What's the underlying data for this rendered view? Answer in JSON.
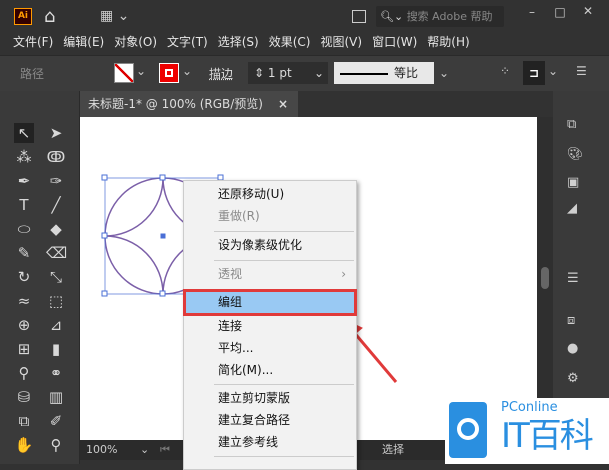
{
  "app": {
    "logo": "Ai",
    "search_placeholder": "搜索 Adobe 帮助"
  },
  "menu": [
    "文件(F)",
    "编辑(E)",
    "对象(O)",
    "文字(T)",
    "选择(S)",
    "效果(C)",
    "视图(V)",
    "窗口(W)",
    "帮助(H)"
  ],
  "control": {
    "object_type": "路径",
    "stroke_label": "描边",
    "stroke_value": "1 pt",
    "profile": "等比"
  },
  "document_tab": {
    "title": "未标题-1* @ 100% (RGB/预览)",
    "close": "×"
  },
  "status": {
    "zoom": "100%",
    "tool": "选择"
  },
  "context_menu": {
    "items": [
      {
        "label": "还原移动(U)",
        "enabled": true
      },
      {
        "label": "重做(R)",
        "enabled": false
      },
      {
        "label": "设为像素级优化",
        "enabled": true
      },
      {
        "label": "透视",
        "enabled": false,
        "submenu": "›"
      },
      {
        "label": "编组",
        "enabled": true,
        "highlighted": true
      },
      {
        "label": "连接",
        "enabled": true
      },
      {
        "label": "平均...",
        "enabled": true
      },
      {
        "label": "简化(M)...",
        "enabled": true
      },
      {
        "label": "建立剪切蒙版",
        "enabled": true
      },
      {
        "label": "建立复合路径",
        "enabled": true
      },
      {
        "label": "建立参考线",
        "enabled": true
      }
    ]
  },
  "watermark": {
    "brand": "PConline",
    "name": "IT百科"
  },
  "colors": {
    "accent_red": "#e03a3a",
    "highlight": "#99c9f3",
    "path": "#7b5fa8"
  }
}
